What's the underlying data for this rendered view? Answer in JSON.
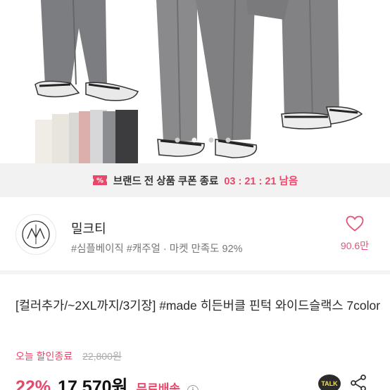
{
  "hero": {
    "image": "grey-wide-slacks-photo",
    "carousel_dots": 5,
    "active_dot": 1
  },
  "coupon_timer": {
    "icon": "coupon-icon",
    "label": "브랜드 전 상품 쿠폰 종료",
    "time_remaining": "03 : 21 : 21 남음"
  },
  "store": {
    "logo": "store-logo",
    "name": "밀크티",
    "tags": "#심플베이직 #캐주얼 · 마켓 만족도 92%",
    "like_icon": "heart-icon",
    "like_count": "90.6만"
  },
  "product": {
    "title": "[컬러추가/~2XL까지/3기장] #made 히든버클 핀턱 와이드슬랙스 7color",
    "discount_label": "오늘 할인종료",
    "original_price": "22,800원",
    "discount_rate": "22%",
    "price": "17,570원",
    "shipping": "무료배송"
  },
  "actions": {
    "talk_label": "TALK",
    "share_icon": "share-icon"
  },
  "colors": {
    "accent": "#e8486a",
    "bar_bg": "#f2f2f3",
    "text": "#222222"
  }
}
